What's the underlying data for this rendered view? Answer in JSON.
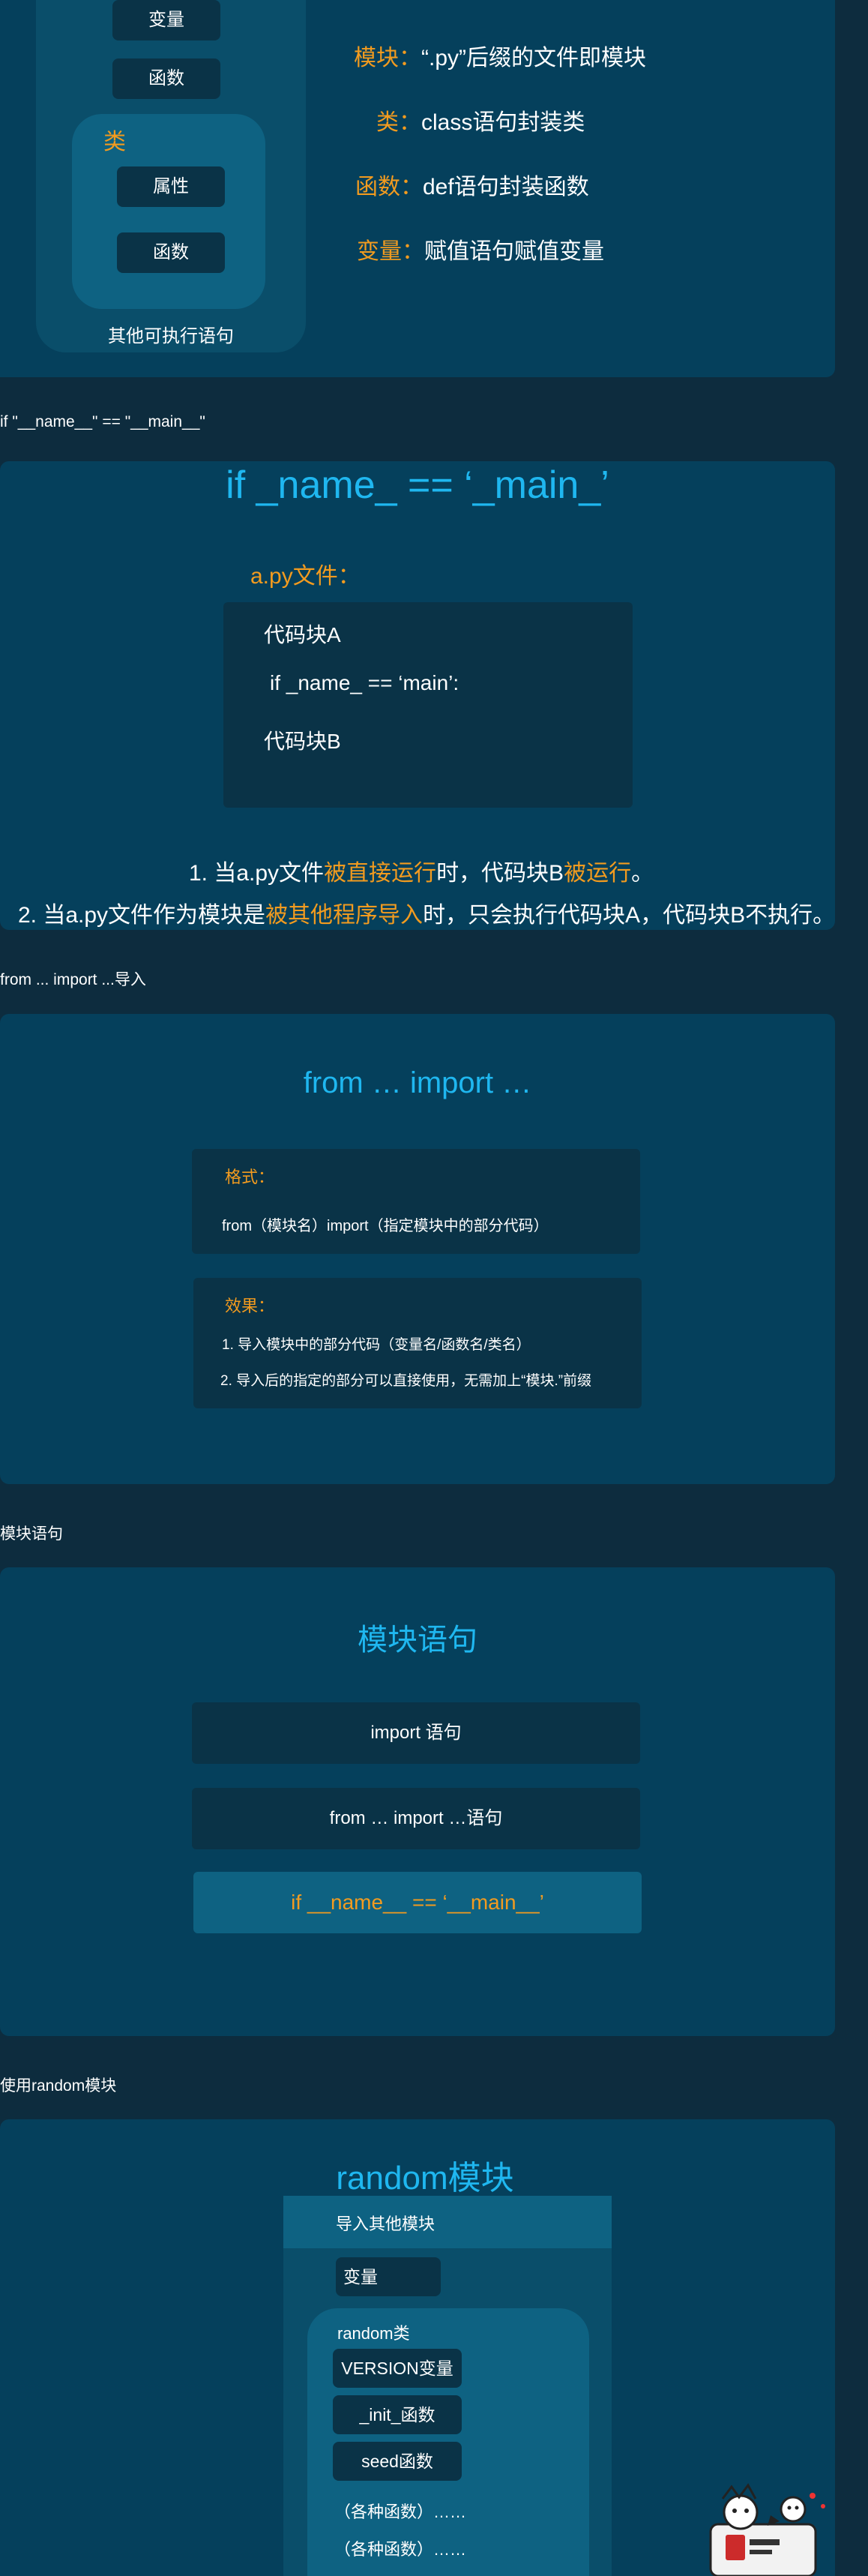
{
  "section1": {
    "outer_items": [
      "变量",
      "函数"
    ],
    "class_label": "类",
    "class_items": [
      "属性",
      "函数"
    ],
    "other_label": "其他可执行语句",
    "definitions": [
      {
        "term": "模块：",
        "desc": "“.py”后缀的文件即模块"
      },
      {
        "term": "类：",
        "desc": "class语句封装类"
      },
      {
        "term": "函数：",
        "desc": "def语句封装函数"
      },
      {
        "term": "变量：",
        "desc": "赋值语句赋值变量"
      }
    ]
  },
  "section2": {
    "caption": "if \"__name__\" == \"__main__\"",
    "title": "if _name_ == ‘_main_’",
    "file_label": "a.py文件：",
    "code_lines": [
      "代码块A",
      "if _name_ == ‘main’:",
      "代码块B"
    ],
    "point1": {
      "a": "1.   当a.py文件",
      "b": "被直接运行",
      "c": "时，代码块B",
      "d": "被运行",
      "e": "。"
    },
    "point2": {
      "a": "2. 当a.py文件作为模块是",
      "b": "被其他程序导入",
      "c": "时，只会执行代码块A，代码块B不执行。"
    }
  },
  "section3": {
    "caption": "from ... import ...导入",
    "title": "from … import …",
    "format_label": "格式：",
    "format_text": "from（模块名）import（指定模块中的部分代码）",
    "effect_label": "效果：",
    "effect_items": [
      "1. 导入模块中的部分代码（变量名/函数名/类名）",
      "2. 导入后的指定的部分可以直接使用，无需加上“模块.”前缀"
    ]
  },
  "section4": {
    "caption": "模块语句",
    "title": "模块语句",
    "items": [
      "import 语句",
      "from … import …语句",
      "if __name__ == ‘__main__’"
    ]
  },
  "section5": {
    "caption": "使用random模块",
    "title": "random模块",
    "import_label": "导入其他模块",
    "var_label": "变量",
    "class_label": "random类",
    "class_items": [
      "VERSION变量",
      "_init_函数",
      "seed函数"
    ],
    "more_items": [
      "（各种函数）……",
      "（各种函数）……"
    ]
  },
  "colors": {
    "background": "#0d2c3e",
    "panel": "#05405c",
    "box": "#0a3347",
    "accent_orange": "#f29b1f",
    "accent_cyan": "#1fb7f0"
  }
}
